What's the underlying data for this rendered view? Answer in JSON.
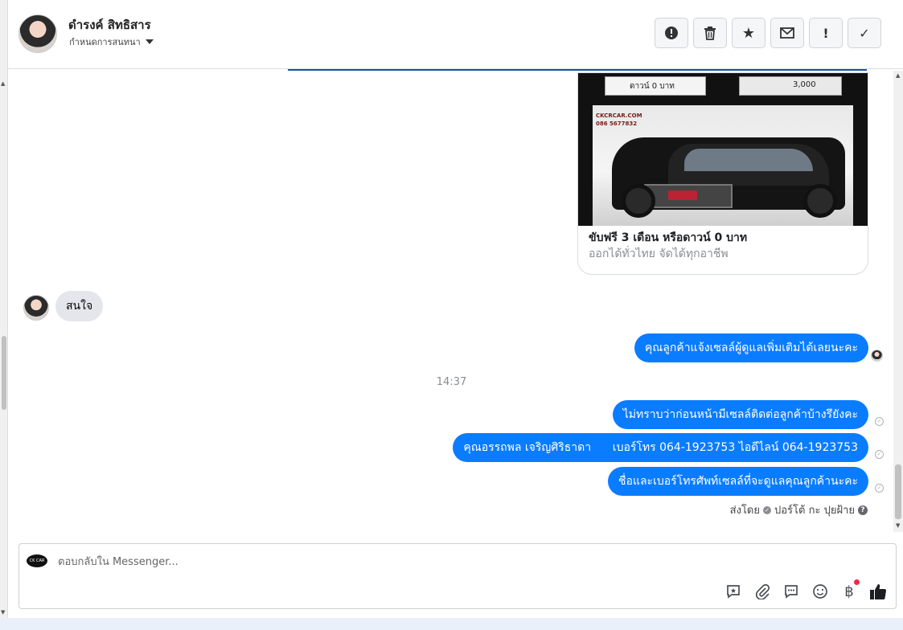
{
  "header": {
    "contact_name": "ดำรงค์ สิทธิสาร",
    "assign_label": "กำหนดการสนทนา",
    "tools": [
      {
        "icon": "spam-alert-icon",
        "glyph": "!"
      },
      {
        "icon": "trash-icon",
        "glyph": "🗑"
      },
      {
        "icon": "star-icon",
        "glyph": "★"
      },
      {
        "icon": "mail-icon",
        "glyph": "✉"
      },
      {
        "icon": "follow-up-icon",
        "glyph": "!"
      },
      {
        "icon": "done-check-icon",
        "glyph": "✓"
      }
    ]
  },
  "card": {
    "strip_left": "ดาวน์ 0 บาท",
    "strip_right": "3,000",
    "logo_text": "CKCRCAR.COM 086 5677832",
    "title": "ขับฟรี 3 เดือน หรือดาวน์ 0 บาท",
    "subtitle": "ออกได้ทั่วไทย จัดได้ทุกอาชีพ"
  },
  "messages": {
    "incoming": "สนใจ",
    "outgoing_1": "คุณลูกค้าแจ้งเซลล์ผู้ดูแลเพิ่มเติมได้เลยนะคะ",
    "time": "14:37",
    "outgoing_2": "ไม่ทราบว่าก่อนหน้ามีเซลล์ติดต่อลูกค้าบ้างรึยังคะ",
    "outgoing_3": "คุณอรรถพล เจริญศิริธาดา      เบอร์โทร 064-1923753 ไอดีไลน์ 064-1923753",
    "outgoing_4": "ชื่อและเบอร์โทรศัพท์เซลล์ที่จะดูแลคุณลูกค้านะคะ",
    "sent_by_prefix": "ส่งโดย",
    "sent_by_name": "ปอร์โต้ กะ ปุยฝ้าย"
  },
  "composer": {
    "placeholder": "ตอบกลับใน Messenger...",
    "page_logo_text": "CK CAR",
    "icons": [
      "saved-reply-icon",
      "attachment-icon",
      "quick-reply-icon",
      "emoji-icon",
      "payment-baht-icon",
      "like-icon"
    ]
  }
}
